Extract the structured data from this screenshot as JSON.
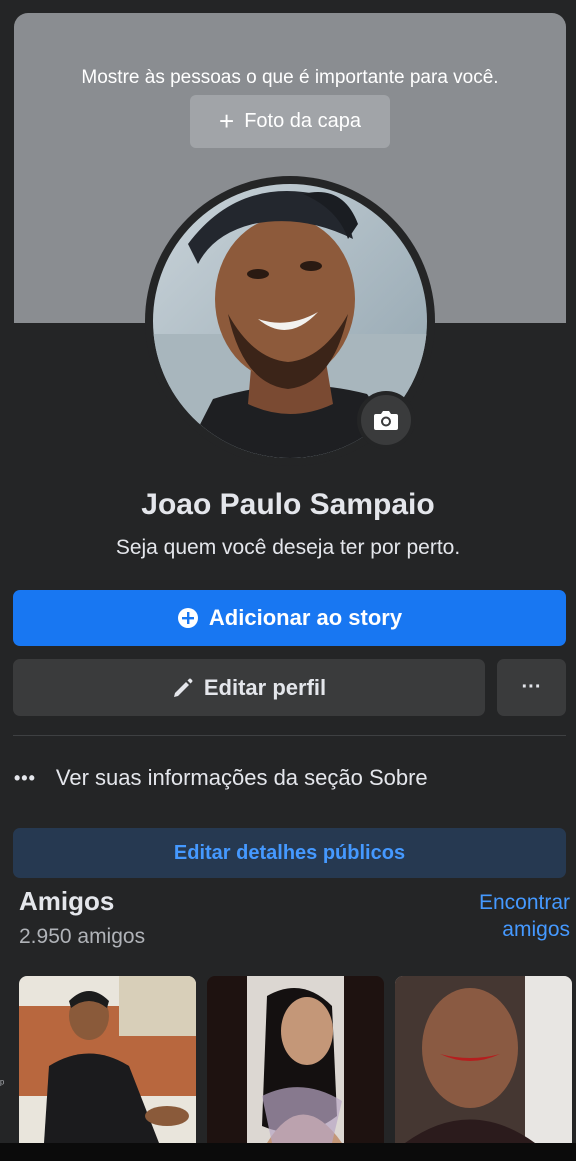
{
  "cover": {
    "prompt": "Mostre às pessoas o que é importante para você.",
    "add_photo_label": "Foto da capa"
  },
  "profile": {
    "name": "Joao Paulo Sampaio",
    "bio": "Seja quem você deseja ter por perto."
  },
  "actions": {
    "add_story_label": "Adicionar ao story",
    "edit_profile_label": "Editar perfil",
    "more_label": "···"
  },
  "about": {
    "label": "Ver suas informações da seção Sobre"
  },
  "edit_details_label": "Editar detalhes públicos",
  "friends": {
    "title": "Amigos",
    "count": "2.950 amigos",
    "find_label": "Encontrar amigos"
  },
  "colors": {
    "background": "#242526",
    "primary": "#1877f2",
    "link": "#4599ff",
    "cover": "#8a8d91"
  },
  "icons": [
    "plus-icon",
    "camera-icon",
    "add-circle-icon",
    "pencil-icon",
    "more-dots-icon"
  ]
}
